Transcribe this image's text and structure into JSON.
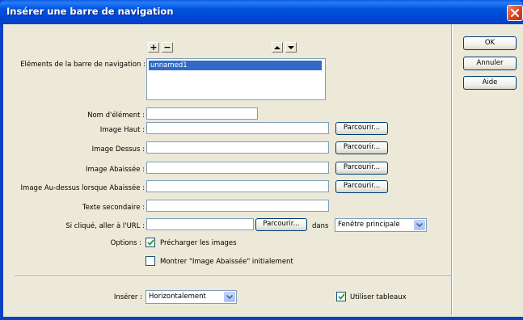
{
  "window": {
    "title": "Insérer une barre de navigation"
  },
  "nav": {
    "label": "Eléments de la barre de navigation :",
    "add_glyph": "+",
    "remove_glyph": "−",
    "items": [
      "unnamed1"
    ]
  },
  "fields": {
    "element_name_label": "Nom d'élément :",
    "image_up_label": "Image Haut :",
    "image_over_label": "Image Dessus :",
    "image_down_label": "Image Abaissée :",
    "image_over_down_label": "Image Au-dessus lorsque Abaissée :",
    "alt_text_label": "Texte secondaire :",
    "url_label": "Si cliqué, aller à l'URL :",
    "browse_label": "Parcourir...",
    "in_label": "dans",
    "target_value": "Fenêtre principale"
  },
  "options": {
    "label": "Options :",
    "preload_label": "Précharger les images",
    "preload_checked": true,
    "show_down_label": "Montrer \"Image Abaissée\" initialement",
    "show_down_checked": false
  },
  "insert": {
    "label": "Insérer :",
    "value": "Horizontalement",
    "use_tables_label": "Utiliser tableaux",
    "use_tables_checked": true
  },
  "buttons": {
    "ok": "OK",
    "cancel": "Annuler",
    "help": "Aide"
  }
}
